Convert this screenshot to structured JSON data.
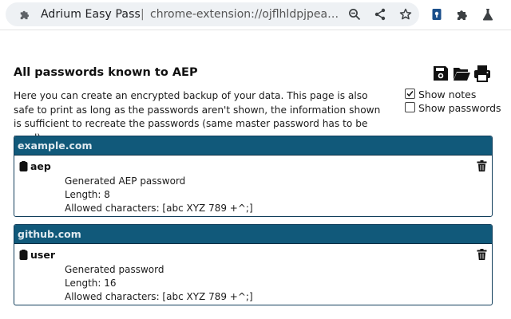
{
  "browser": {
    "extension_name": "Adrium Easy Pass",
    "separator": "|",
    "url": "chrome-extension://ojflhldpjpeaggfoo…",
    "omnibox_icons": [
      "zoom-icon",
      "share-icon",
      "bookmark-star-icon"
    ],
    "toolbar_icons": [
      "aep-extension-icon",
      "extensions-puzzle-icon",
      "flask-icon"
    ]
  },
  "page": {
    "title": "All passwords known to AEP",
    "intro": "Here you can create an encrypted backup of your data. This page is also safe to print as long as the passwords aren't shown, the information shown is sufficient to recreate the passwords (same master password has to be used).",
    "action_icons": [
      "save-icon",
      "open-folder-icon",
      "print-icon"
    ],
    "options": {
      "show_notes": {
        "label": "Show notes",
        "checked": true
      },
      "show_passwords": {
        "label": "Show passwords",
        "checked": false
      }
    }
  },
  "sites": [
    {
      "name": "example.com",
      "user": "aep",
      "type": "Generated AEP password",
      "length": "Length: 8",
      "allowed": "Allowed characters: [abc XYZ 789 +^;]"
    },
    {
      "name": "github.com",
      "user": "user",
      "type": "Generated password",
      "length": "Length: 16",
      "allowed": "Allowed characters: [abc XYZ 789 +^;]"
    }
  ],
  "colors": {
    "site_header": "#11597a",
    "site_border": "#123f5c",
    "omnibox_bg": "#eef1f4",
    "extension_blue": "#1a4f8b"
  }
}
